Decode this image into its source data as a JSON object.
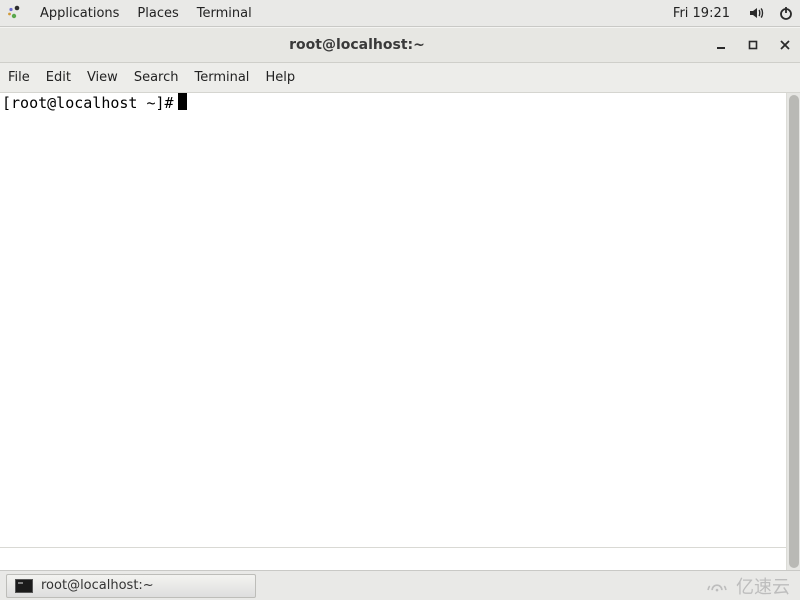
{
  "panel": {
    "menus": [
      "Applications",
      "Places",
      "Terminal"
    ],
    "clock": "Fri 19:21"
  },
  "window": {
    "title": "root@localhost:~"
  },
  "menubar": {
    "items": [
      "File",
      "Edit",
      "View",
      "Search",
      "Terminal",
      "Help"
    ]
  },
  "terminal": {
    "prompt": "[root@localhost ~]#"
  },
  "taskbar": {
    "task_label": "root@localhost:~"
  },
  "watermark": {
    "text": "亿速云"
  }
}
